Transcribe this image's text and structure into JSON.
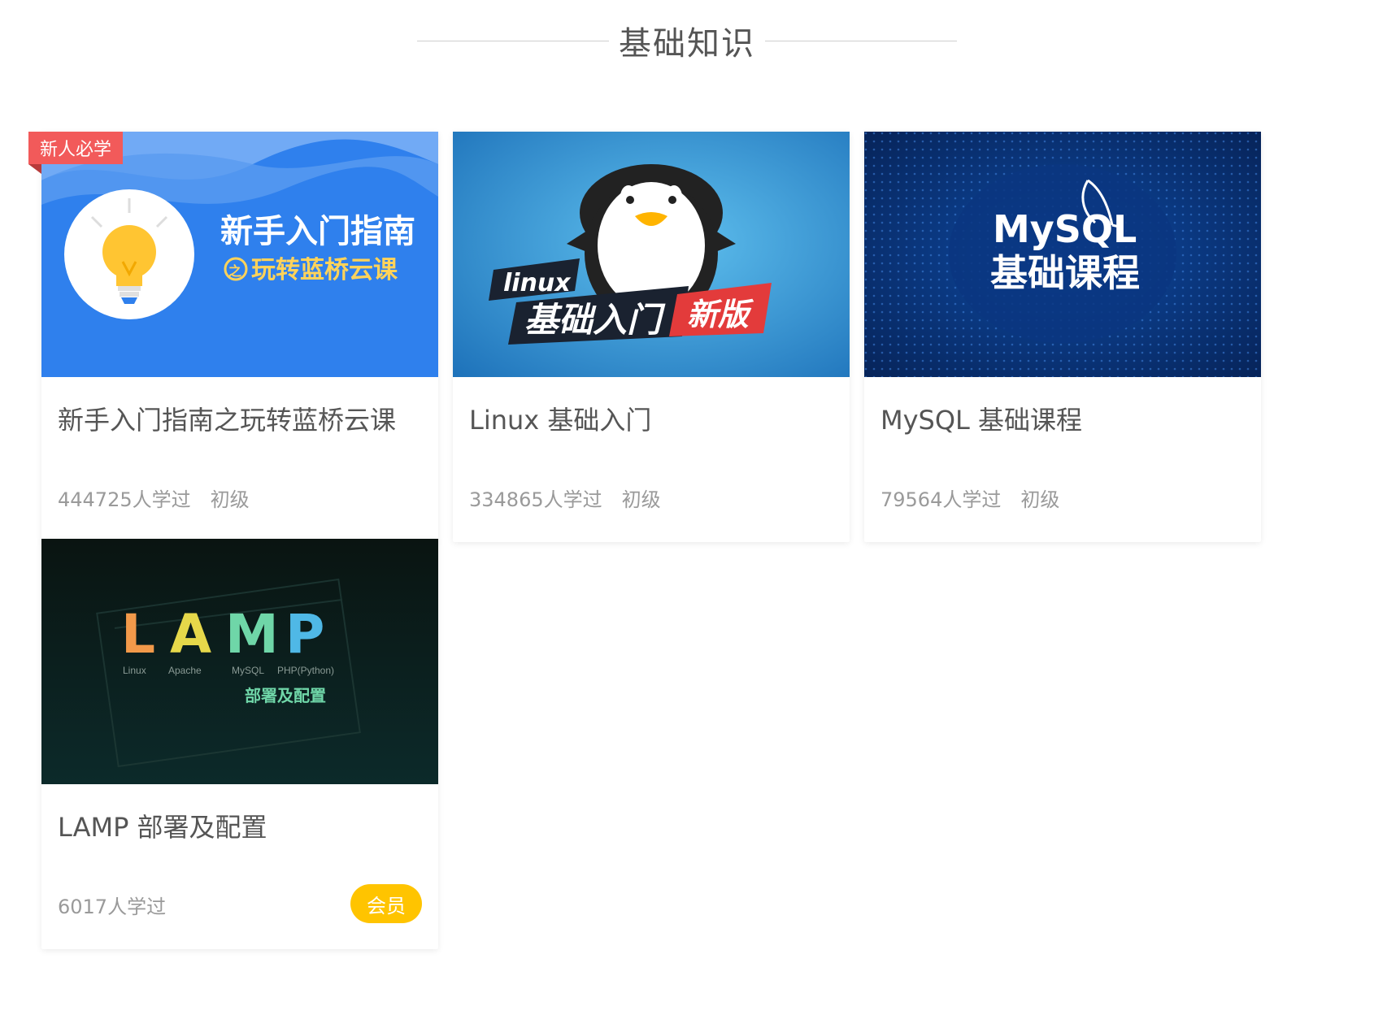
{
  "section": {
    "title": "基础知识"
  },
  "courses": [
    {
      "title": "新手入门指南之玩转蓝桥云课",
      "learners": "444725人学过",
      "level": "初级",
      "corner_badge": "新人必学",
      "thumb": {
        "line1": "新手入门指南",
        "line2": "玩转蓝桥云课",
        "bullet": "之"
      }
    },
    {
      "title": "Linux 基础入门",
      "learners": "334865人学过",
      "level": "初级",
      "thumb": {
        "brand": "linux",
        "main": "基础入门",
        "tag": "新版"
      }
    },
    {
      "title": "MySQL 基础课程",
      "learners": "79564人学过",
      "level": "初级",
      "thumb": {
        "brand": "MySQL",
        "main": "基础课程"
      }
    },
    {
      "title": "LAMP 部署及配置",
      "learners": "6017人学过",
      "member_badge": "会员",
      "thumb": {
        "letters": [
          "L",
          "A",
          "M",
          "P"
        ],
        "sublabels": [
          "Linux",
          "Apache",
          "MySQL",
          "PHP(Python)"
        ],
        "caption": "部署及配置"
      }
    }
  ],
  "colors": {
    "corner_badge": "#f25a5a",
    "member_badge": "#ffc400",
    "lamp_letters": [
      "#f2994a",
      "#e6d84a",
      "#6fd6a8",
      "#4fb8e6"
    ]
  }
}
